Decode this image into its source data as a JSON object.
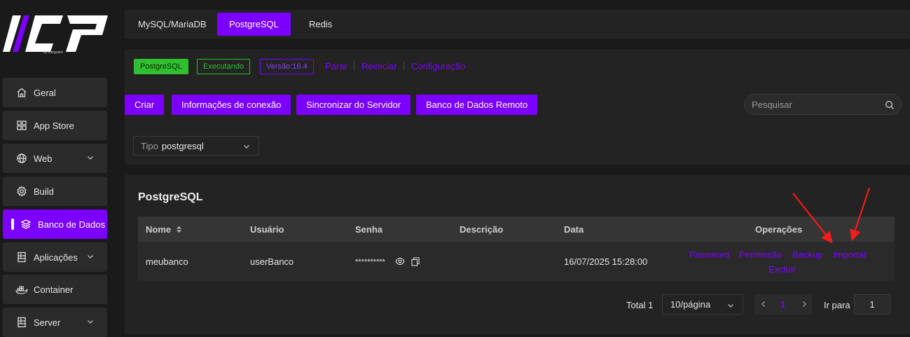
{
  "colors": {
    "accent": "#7c00ff",
    "running_green": "#2fbf2f"
  },
  "sidebar": {
    "brand": "by Integrator",
    "items": [
      {
        "label": "Geral",
        "icon": "home-icon"
      },
      {
        "label": "App Store",
        "icon": "grid-icon"
      },
      {
        "label": "Web",
        "icon": "globe-icon"
      },
      {
        "label": "Build",
        "icon": "gear-icon"
      },
      {
        "label": "Banco de Dados",
        "icon": "database-icon"
      },
      {
        "label": "Aplicações",
        "icon": "server-icon"
      },
      {
        "label": "Container",
        "icon": "docker-icon"
      },
      {
        "label": "Server",
        "icon": "server-icon"
      }
    ]
  },
  "tabs": [
    {
      "label": "MySQL/MariaDB"
    },
    {
      "label": "PostgreSQL"
    },
    {
      "label": "Redis"
    }
  ],
  "status": {
    "app_badge": "PostgreSQL",
    "state_badge": "Executando",
    "version_badge": "Versão:16.4",
    "actions": [
      "Parar",
      "Reiniciar",
      "Configuração"
    ]
  },
  "toolbar": {
    "buttons": [
      "Criar",
      "Informações de conexão",
      "Sincronizar do Servidor",
      "Banco de Dados Remoto"
    ],
    "search_placeholder": "Pesquisar"
  },
  "filter": {
    "label": "Tipo",
    "value": "postgresql"
  },
  "table": {
    "title": "PostgreSQL",
    "columns": [
      "Nome",
      "Usuário",
      "Senha",
      "Descrição",
      "Data",
      "Operações"
    ],
    "rows": [
      {
        "name": "meubanco",
        "user": "userBanco",
        "password": "**********",
        "description": "",
        "date": "16/07/2025 15:28:00",
        "operations": [
          "Password",
          "Permissão",
          "Backup",
          "Importar",
          "Excluir"
        ]
      }
    ]
  },
  "pagination": {
    "total": "Total 1",
    "page_size": "10/página",
    "current_page": "1",
    "goto_label": "Ir para",
    "goto_value": "1"
  }
}
